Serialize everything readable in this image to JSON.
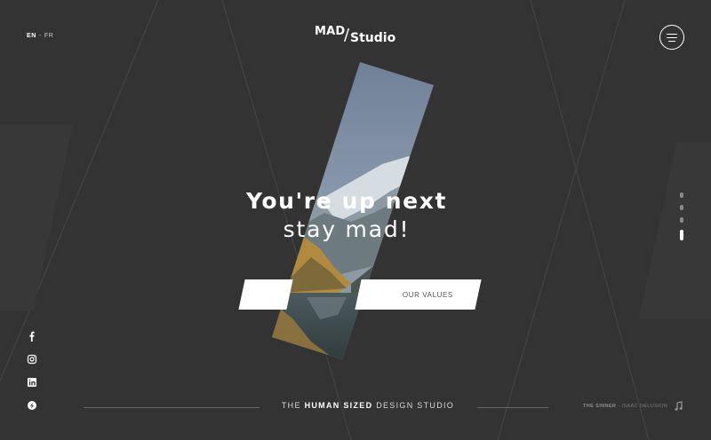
{
  "header": {
    "languages": [
      {
        "code": "EN",
        "active": true
      },
      {
        "code": "FR",
        "active": false
      }
    ],
    "lang_separator": "-",
    "logo": {
      "part1": "MAD",
      "slash": "/",
      "part2": "Studio"
    },
    "menu_icon": "hamburger-icon"
  },
  "hero": {
    "headline_line1": "You're up next",
    "headline_line2": "stay mad!",
    "cta_right_label": "OUR VALUES"
  },
  "slider": {
    "dot_count": 4,
    "active_index": 3
  },
  "social": [
    {
      "icon": "facebook-icon"
    },
    {
      "icon": "instagram-icon"
    },
    {
      "icon": "linkedin-icon"
    },
    {
      "icon": "behance-icon"
    }
  ],
  "footer": {
    "tagline_pre": "THE ",
    "tagline_bold": "HUMAN SIZED",
    "tagline_post": " DESIGN STUDIO",
    "credit_song": "THE SINNER",
    "credit_sep": " - ",
    "credit_artist": "ISAAC DELUSION",
    "credit_icon": "music-note-icon"
  },
  "colors": {
    "background": "#333333",
    "line": "#4a4a4a",
    "accent": "#ffffff"
  }
}
